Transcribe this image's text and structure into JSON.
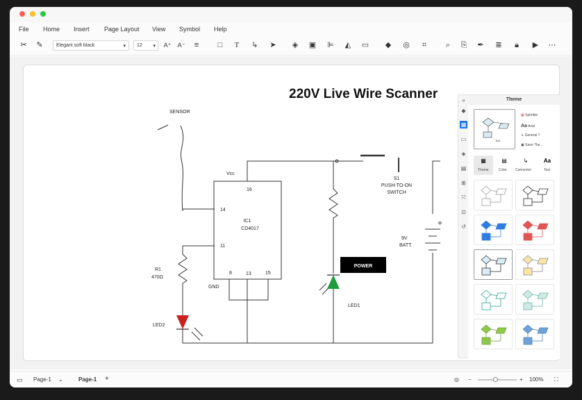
{
  "menu": [
    "File",
    "Home",
    "Insert",
    "Page Layout",
    "View",
    "Symbol",
    "Help"
  ],
  "toolbar": {
    "font": "Elegant soft black",
    "size": "12"
  },
  "diagram": {
    "title": "220V Live Wire Scanner",
    "sensor": "SENSOR",
    "vcc": "Vcc",
    "ic_name": "IC1",
    "ic_model": "CD4017",
    "pin14": "14",
    "pin16": "16",
    "pin11": "11",
    "pin8": "8",
    "pin13": "13",
    "pin15": "15",
    "gnd": "GND",
    "r1": "R1",
    "r1_value": "470Ω",
    "led2": "LED2",
    "led1": "LED1",
    "power": "POWER",
    "switch_id": "S1",
    "switch_label": "PUSH-TO-ON",
    "switch_label2": "SWITCH",
    "battery": "9V",
    "battery2": "BATT."
  },
  "panel": {
    "title": "Theme",
    "options": [
      "Sprinkle",
      "Arial",
      "General 7",
      "Save The..."
    ],
    "tabs": [
      "Theme",
      "Color",
      "Connector",
      "Text"
    ],
    "preview_text": "Text"
  },
  "status": {
    "page_left": "Page-1",
    "page_tab": "Page-1",
    "zoom": "100%"
  },
  "colors": {
    "led2": "#cc1f1f",
    "led1": "#1f9c3c",
    "power_box": "#000000",
    "accent": "#1a73e8"
  },
  "theme_tiles": [
    {
      "diamond": "#ffffff",
      "rect": "#ffffff",
      "para": "#ffffff",
      "stroke": "#999999"
    },
    {
      "diamond": "#ffffff",
      "rect": "#ffffff",
      "para": "#ffffff",
      "stroke": "#222222"
    },
    {
      "diamond": "#2f7de1",
      "rect": "#2f7de1",
      "para": "#2f7de1",
      "stroke": "#2f7de1"
    },
    {
      "diamond": "#e05656",
      "rect": "#e05656",
      "para": "#e05656",
      "stroke": "#e05656"
    },
    {
      "diamond": "#d9ecf6",
      "rect": "#d9ecf6",
      "para": "#d9ecf6",
      "stroke": "#333333"
    },
    {
      "diamond": "#fbe6a8",
      "rect": "#fbe6a8",
      "para": "#fbe6a8",
      "stroke": "#888888"
    },
    {
      "diamond": "#ffffff",
      "rect": "#ffffff",
      "para": "#ffffff",
      "stroke": "#2a9d8f"
    },
    {
      "diamond": "#cfe9e4",
      "rect": "#cfe9e4",
      "para": "#cfe9e4",
      "stroke": "#6fb8a8"
    },
    {
      "diamond": "#8fc84a",
      "rect": "#8fc84a",
      "para": "#8fc84a",
      "stroke": "#6aa033"
    },
    {
      "diamond": "#6fa2d8",
      "rect": "#6fa2d8",
      "para": "#6fa2d8",
      "stroke": "#4d82bd"
    }
  ]
}
